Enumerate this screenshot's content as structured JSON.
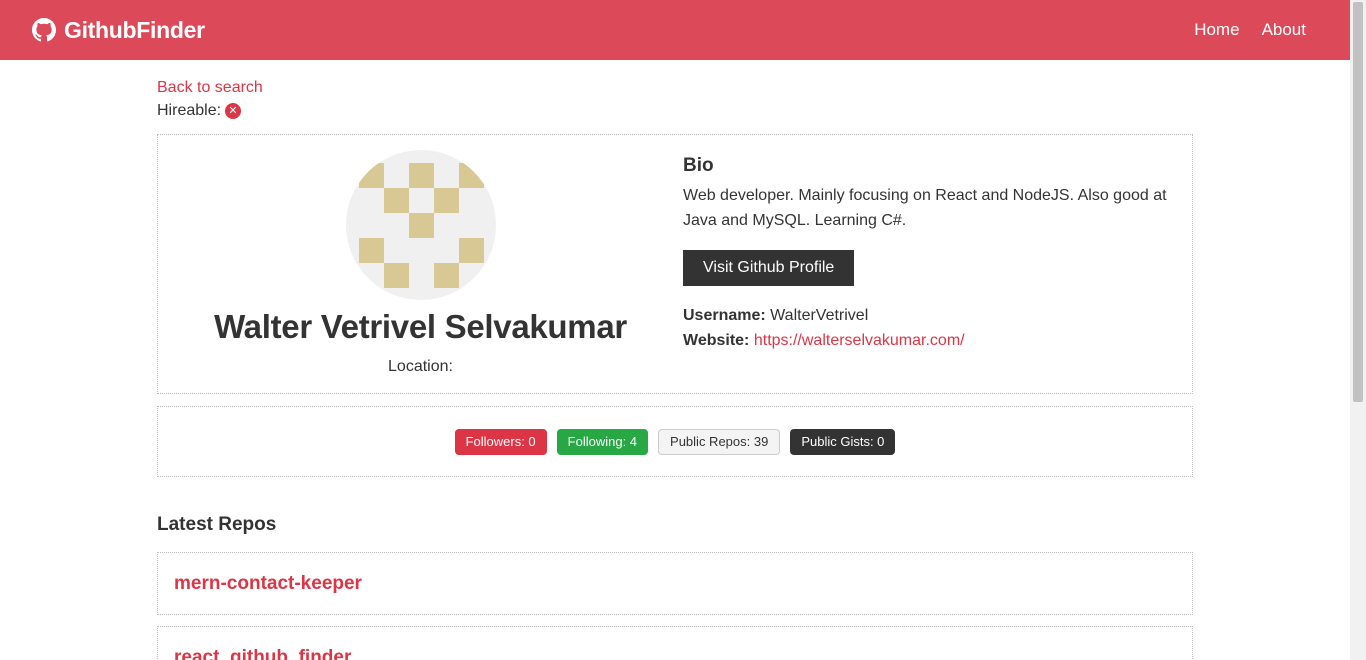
{
  "navbar": {
    "brand": "GithubFinder",
    "links": [
      "Home",
      "About"
    ]
  },
  "back_link": "Back to search",
  "hireable_label": "Hireable:",
  "profile": {
    "name": "Walter Vetrivel Selvakumar",
    "location_label": "Location:",
    "bio_title": "Bio",
    "bio": "Web developer. Mainly focusing on React and NodeJS. Also good at Java and MySQL. Learning C#.",
    "visit_button": "Visit Github Profile",
    "username_label": "Username:",
    "username": "WalterVetrivel",
    "website_label": "Website:",
    "website": "https://walterselvakumar.com/"
  },
  "stats": {
    "followers": "Followers: 0",
    "following": "Following: 4",
    "public_repos": "Public Repos: 39",
    "public_gists": "Public Gists: 0"
  },
  "repos": {
    "title": "Latest Repos",
    "items": [
      "mern-contact-keeper",
      "react_github_finder"
    ]
  },
  "colors": {
    "navbar": "#dc4a5a",
    "primary_red": "#dc3545",
    "success_green": "#28a745",
    "dark": "#333333",
    "avatar_tile": "#d8c994"
  },
  "icons": {
    "brand": "github-icon",
    "hireable": "x-circle-icon"
  }
}
